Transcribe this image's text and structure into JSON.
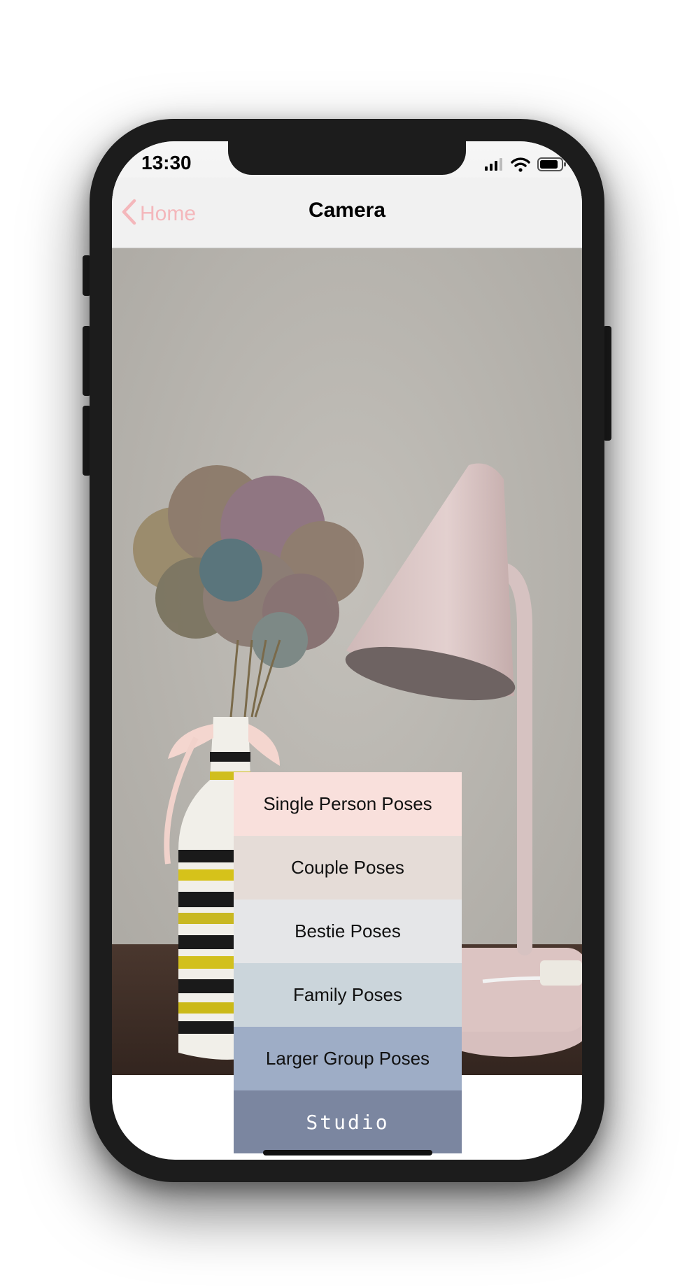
{
  "status_bar": {
    "time": "13:30",
    "icons": [
      "signal-icon",
      "wifi-icon",
      "battery-icon"
    ]
  },
  "nav": {
    "back_label": "Home",
    "title": "Camera",
    "back_color": "#f4b7bb"
  },
  "menu": {
    "items": [
      {
        "label": "Single Person Poses",
        "color": "#f9e0dc"
      },
      {
        "label": "Couple Poses",
        "color": "#e5dcd7"
      },
      {
        "label": "Bestie Poses",
        "color": "#e5e6e8"
      },
      {
        "label": "Family Poses",
        "color": "#cbd5db"
      },
      {
        "label": "Larger Group Poses",
        "color": "#9eadc6"
      }
    ],
    "studio_label": "Studio",
    "studio_color": "#7b86a0"
  }
}
